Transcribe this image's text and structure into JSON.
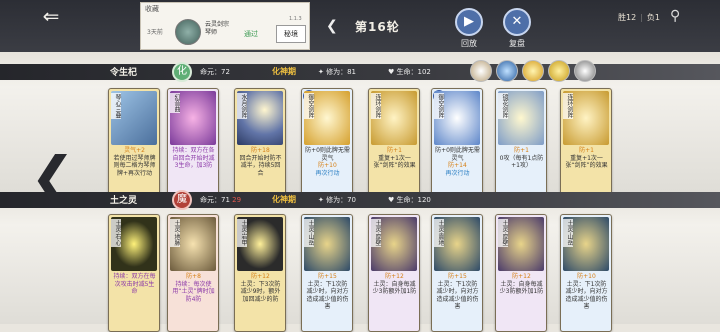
{
  "top": {
    "back": "⇐",
    "collect_label": "收藏",
    "collect_days": "3天前",
    "collect_name_line1": "云灵剑宗",
    "collect_name_line2": "琴师",
    "collect_pass": "通过",
    "collect_state": "秘境",
    "collect_version": "1.1.3",
    "round_arrow": "❮",
    "round": "第16轮",
    "replay_label": "回放",
    "replay_icon": "▶",
    "review_label": "复盘",
    "review_icon": "✕",
    "score_win": "胜12",
    "score_lose": "负1",
    "share_icon": "⚲",
    "colors": {
      "accent_blue": "#4e6fa8",
      "realm_gold": "#f0c040",
      "lost_red": "#e4594d",
      "pass_green": "#3d9a54"
    }
  },
  "player1": {
    "name": "令生杞",
    "realm_char": "化",
    "mingyuan_label": "命元：",
    "mingyuan": "72",
    "realm": "化神期",
    "cult_label": "修为：",
    "cult": "81",
    "hp_label": "生命：",
    "hp": "102",
    "cards": [
      {
        "title": "琴心三叠",
        "lines": [
          "灵气+2",
          "若使用过琴师牌则每二格为琴师牌+再次行动"
        ]
      },
      {
        "title": "幻音曲",
        "lines": [
          "持续：双方在各自回合开始时减3生命，加3防"
        ]
      },
      {
        "title": "水月剑阵",
        "lines": [
          "防+18",
          "回合开始时防不减半，持续5回合"
        ]
      },
      {
        "title": "御空剑阵",
        "lines": [
          "防+0则此牌无需灵气",
          "防+10",
          "再次行动"
        ]
      },
      {
        "title": "连环剑阵",
        "lines": [
          "防+1",
          "重复+1次一张“剑阵”的效果"
        ]
      },
      {
        "title": "御空剑阵",
        "lines": [
          "防+0则此牌无需灵气",
          "防+14",
          "再次行动"
        ]
      },
      {
        "title": "镜花剑阵",
        "lines": [
          "防+1",
          "0攻（每有1点防+1攻）"
        ]
      },
      {
        "title": "连环剑阵",
        "lines": [
          "防+1",
          "重复+1次一张“剑阵”的效果"
        ]
      }
    ]
  },
  "player2": {
    "name": "土之灵",
    "realm_char": "魔",
    "mingyuan_label": "命元：",
    "mingyuan": "71",
    "mingyuan_lost": "29",
    "realm": "化神期",
    "cult_label": "修为：",
    "cult": "70",
    "hp_label": "生命：",
    "hp": "120",
    "cards": [
      {
        "title": "土灵·石心",
        "lines": [
          "持续：双方在每次攻击时减5生命"
        ]
      },
      {
        "title": "土灵·地脉",
        "lines": [
          "防+8",
          "持续：每次使用“土灵”牌时加防4防"
        ]
      },
      {
        "title": "土灵·岩甲",
        "lines": [
          "防+12",
          "土灵：下3次防减少9时，额外加回减少的防"
        ]
      },
      {
        "title": "土灵·山岳",
        "lines": [
          "防+15",
          "土灵：下1次防减少时，向对方造成减少值的伤害"
        ]
      },
      {
        "title": "土灵·厚壁",
        "lines": [
          "防+12",
          "土灵：自身每减少3防额外加1防"
        ]
      },
      {
        "title": "土灵·震地",
        "lines": [
          "防+15",
          "土灵：下1次防减少时，向对方造成减少值的伤害"
        ]
      },
      {
        "title": "土灵·厚壁",
        "lines": [
          "防+12",
          "土灵：自身每减少3防额外加1防"
        ]
      },
      {
        "title": "土灵·山岳",
        "lines": [
          "防+10",
          "土灵：下1次防减少时，向对方造成减少值的伤害"
        ]
      }
    ]
  },
  "side_arrow": "❮"
}
